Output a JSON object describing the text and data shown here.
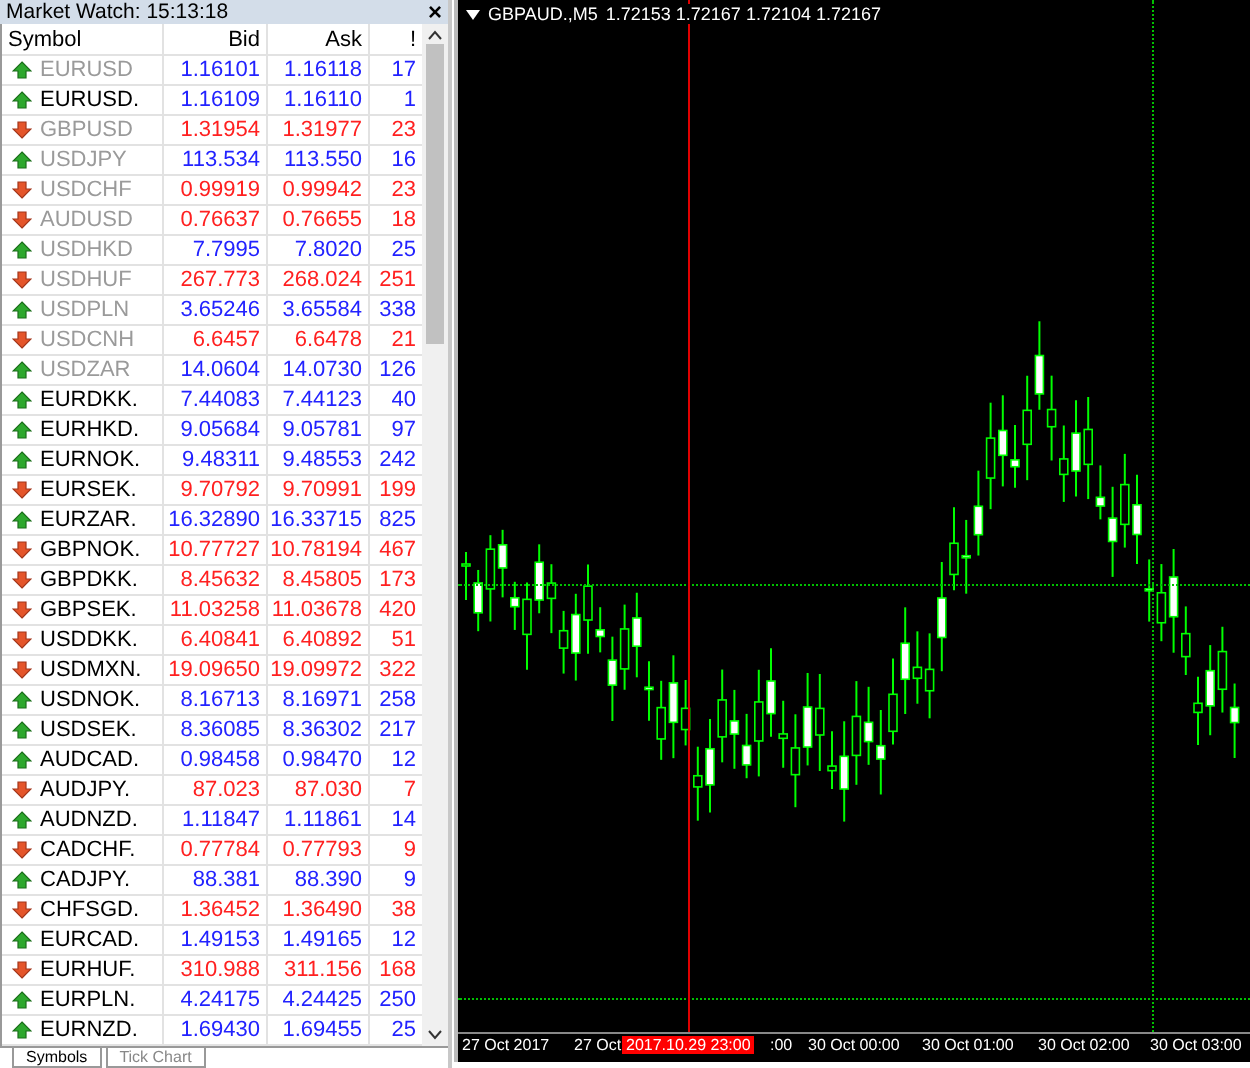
{
  "market_watch": {
    "title": "Market Watch: 15:13:18",
    "close": "×",
    "columns": [
      "Symbol",
      "Bid",
      "Ask",
      "!"
    ],
    "rows": [
      {
        "symbol": "EURUSD",
        "bid": "1.16101",
        "ask": "1.16118",
        "spread": "17",
        "kind": "up",
        "greyed": true
      },
      {
        "symbol": "EURUSD.",
        "bid": "1.16109",
        "ask": "1.16110",
        "spread": "1",
        "kind": "up",
        "greyed": false
      },
      {
        "symbol": "GBPUSD",
        "bid": "1.31954",
        "ask": "1.31977",
        "spread": "23",
        "kind": "down",
        "greyed": true
      },
      {
        "symbol": "USDJPY",
        "bid": "113.534",
        "ask": "113.550",
        "spread": "16",
        "kind": "up",
        "greyed": true
      },
      {
        "symbol": "USDCHF",
        "bid": "0.99919",
        "ask": "0.99942",
        "spread": "23",
        "kind": "down",
        "greyed": true
      },
      {
        "symbol": "AUDUSD",
        "bid": "0.76637",
        "ask": "0.76655",
        "spread": "18",
        "kind": "down",
        "greyed": true
      },
      {
        "symbol": "USDHKD",
        "bid": "7.7995",
        "ask": "7.8020",
        "spread": "25",
        "kind": "up",
        "greyed": true
      },
      {
        "symbol": "USDHUF",
        "bid": "267.773",
        "ask": "268.024",
        "spread": "251",
        "kind": "down",
        "greyed": true
      },
      {
        "symbol": "USDPLN",
        "bid": "3.65246",
        "ask": "3.65584",
        "spread": "338",
        "kind": "up",
        "greyed": true
      },
      {
        "symbol": "USDCNH",
        "bid": "6.6457",
        "ask": "6.6478",
        "spread": "21",
        "kind": "down",
        "greyed": true
      },
      {
        "symbol": "USDZAR",
        "bid": "14.0604",
        "ask": "14.0730",
        "spread": "126",
        "kind": "up",
        "greyed": true
      },
      {
        "symbol": "EURDKK.",
        "bid": "7.44083",
        "ask": "7.44123",
        "spread": "40",
        "kind": "up",
        "greyed": false
      },
      {
        "symbol": "EURHKD.",
        "bid": "9.05684",
        "ask": "9.05781",
        "spread": "97",
        "kind": "up",
        "greyed": false
      },
      {
        "symbol": "EURNOK.",
        "bid": "9.48311",
        "ask": "9.48553",
        "spread": "242",
        "kind": "up",
        "greyed": false
      },
      {
        "symbol": "EURSEK.",
        "bid": "9.70792",
        "ask": "9.70991",
        "spread": "199",
        "kind": "down",
        "greyed": false
      },
      {
        "symbol": "EURZAR.",
        "bid": "16.32890",
        "ask": "16.33715",
        "spread": "825",
        "kind": "up",
        "greyed": false
      },
      {
        "symbol": "GBPNOK.",
        "bid": "10.77727",
        "ask": "10.78194",
        "spread": "467",
        "kind": "down",
        "greyed": false
      },
      {
        "symbol": "GBPDKK.",
        "bid": "8.45632",
        "ask": "8.45805",
        "spread": "173",
        "kind": "down",
        "greyed": false
      },
      {
        "symbol": "GBPSEK.",
        "bid": "11.03258",
        "ask": "11.03678",
        "spread": "420",
        "kind": "down",
        "greyed": false
      },
      {
        "symbol": "USDDKK.",
        "bid": "6.40841",
        "ask": "6.40892",
        "spread": "51",
        "kind": "down",
        "greyed": false
      },
      {
        "symbol": "USDMXN.",
        "bid": "19.09650",
        "ask": "19.09972",
        "spread": "322",
        "kind": "down",
        "greyed": false
      },
      {
        "symbol": "USDNOK.",
        "bid": "8.16713",
        "ask": "8.16971",
        "spread": "258",
        "kind": "up",
        "greyed": false
      },
      {
        "symbol": "USDSEK.",
        "bid": "8.36085",
        "ask": "8.36302",
        "spread": "217",
        "kind": "up",
        "greyed": false
      },
      {
        "symbol": "AUDCAD.",
        "bid": "0.98458",
        "ask": "0.98470",
        "spread": "12",
        "kind": "up",
        "greyed": false
      },
      {
        "symbol": "AUDJPY.",
        "bid": "87.023",
        "ask": "87.030",
        "spread": "7",
        "kind": "down",
        "greyed": false
      },
      {
        "symbol": "AUDNZD.",
        "bid": "1.11847",
        "ask": "1.11861",
        "spread": "14",
        "kind": "up",
        "greyed": false
      },
      {
        "symbol": "CADCHF.",
        "bid": "0.77784",
        "ask": "0.77793",
        "spread": "9",
        "kind": "down",
        "greyed": false
      },
      {
        "symbol": "CADJPY.",
        "bid": "88.381",
        "ask": "88.390",
        "spread": "9",
        "kind": "up",
        "greyed": false
      },
      {
        "symbol": "CHFSGD.",
        "bid": "1.36452",
        "ask": "1.36490",
        "spread": "38",
        "kind": "down",
        "greyed": false
      },
      {
        "symbol": "EURCAD.",
        "bid": "1.49153",
        "ask": "1.49165",
        "spread": "12",
        "kind": "up",
        "greyed": false
      },
      {
        "symbol": "EURHUF.",
        "bid": "310.988",
        "ask": "311.156",
        "spread": "168",
        "kind": "down",
        "greyed": false
      },
      {
        "symbol": "EURPLN.",
        "bid": "4.24175",
        "ask": "4.24425",
        "spread": "250",
        "kind": "up",
        "greyed": false
      },
      {
        "symbol": "EURNZD.",
        "bid": "1.69430",
        "ask": "1.69455",
        "spread": "25",
        "kind": "up",
        "greyed": false
      }
    ],
    "tabs": [
      {
        "label": "Symbols",
        "selected": true
      },
      {
        "label": "Tick Chart",
        "selected": false
      }
    ]
  },
  "chart": {
    "symbol": "GBPAUD.,M5",
    "prices": [
      "1.72153",
      "1.72167",
      "1.72104",
      "1.72167"
    ],
    "time_labels": [
      "27 Oct 2017",
      "27 Oct",
      ":00",
      "30 Oct 00:00",
      "30 Oct 01:00",
      "30 Oct 02:00",
      "30 Oct 03:00"
    ],
    "cursor_time": "2017.10.29 23:00"
  }
}
